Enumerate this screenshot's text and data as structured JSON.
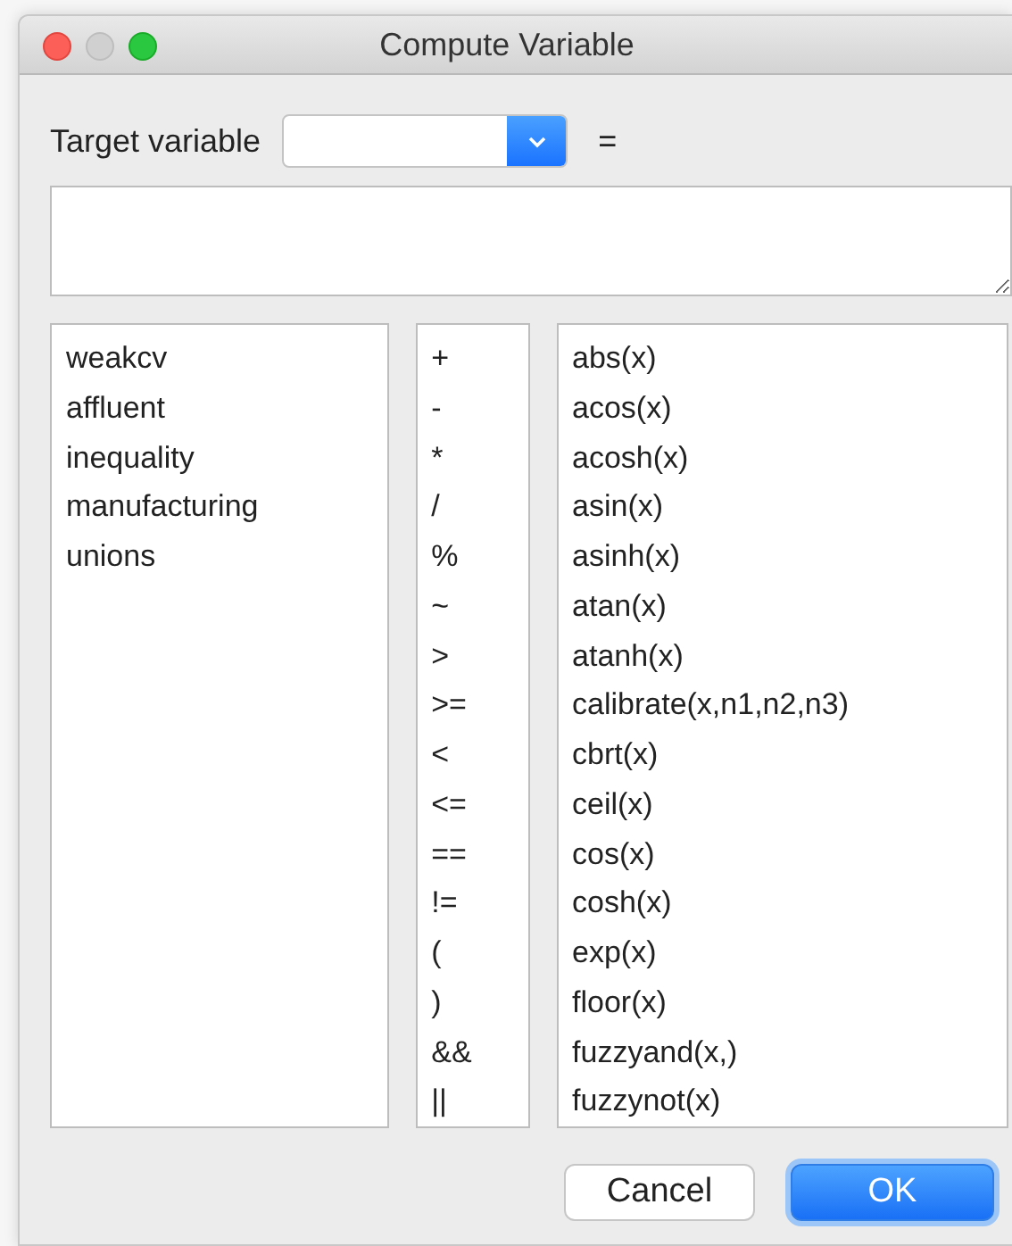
{
  "window": {
    "title": "Compute Variable",
    "controls": [
      {
        "kind": "close",
        "disabled": false
      },
      {
        "kind": "minimize",
        "disabled": true
      },
      {
        "kind": "zoom",
        "disabled": false
      }
    ]
  },
  "target": {
    "label": "Target variable",
    "equals": "="
  },
  "variables": [
    "weakcv",
    "affluent",
    "inequality",
    "manufacturing",
    "unions"
  ],
  "operators": [
    "+",
    "-",
    "*",
    "/",
    "%",
    "~",
    ">",
    ">=",
    "<",
    "<=",
    "==",
    "!=",
    "(",
    ")",
    "&&",
    "||"
  ],
  "functions": [
    "abs(x)",
    "acos(x)",
    "acosh(x)",
    "asin(x)",
    "asinh(x)",
    "atan(x)",
    "atanh(x)",
    "calibrate(x,n1,n2,n3)",
    "cbrt(x)",
    "ceil(x)",
    "cos(x)",
    "cosh(x)",
    "exp(x)",
    "floor(x)",
    "fuzzyand(x,)",
    "fuzzynot(x)"
  ],
  "buttons": [
    {
      "label": "Cancel",
      "kind": "default"
    },
    {
      "label": "OK",
      "kind": "primary"
    }
  ]
}
